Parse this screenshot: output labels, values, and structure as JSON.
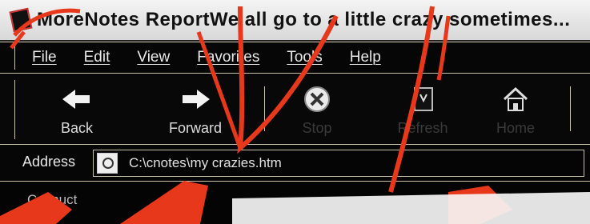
{
  "window": {
    "title": "MoreNotes ReportWe all go to a little crazy sometimes..."
  },
  "menu": {
    "items": [
      {
        "label": "File"
      },
      {
        "label": "Edit"
      },
      {
        "label": "View"
      },
      {
        "label": "Favorites"
      },
      {
        "label": "Tools"
      },
      {
        "label": "Help"
      }
    ]
  },
  "toolbar": {
    "buttons": [
      {
        "label": "Back",
        "icon": "back-arrow-icon"
      },
      {
        "label": "Forward",
        "icon": "forward-arrow-icon"
      },
      {
        "label": "Stop",
        "icon": "stop-icon"
      },
      {
        "label": "Refresh",
        "icon": "refresh-icon"
      },
      {
        "label": "Home",
        "icon": "home-icon"
      }
    ]
  },
  "address": {
    "label": "Address",
    "value": "C:\\cnotes\\my crazies.htm"
  },
  "status": {
    "text": "Cconuct"
  },
  "colors": {
    "scribble": "#e8381c",
    "chrome_line": "#c9c2a8"
  }
}
